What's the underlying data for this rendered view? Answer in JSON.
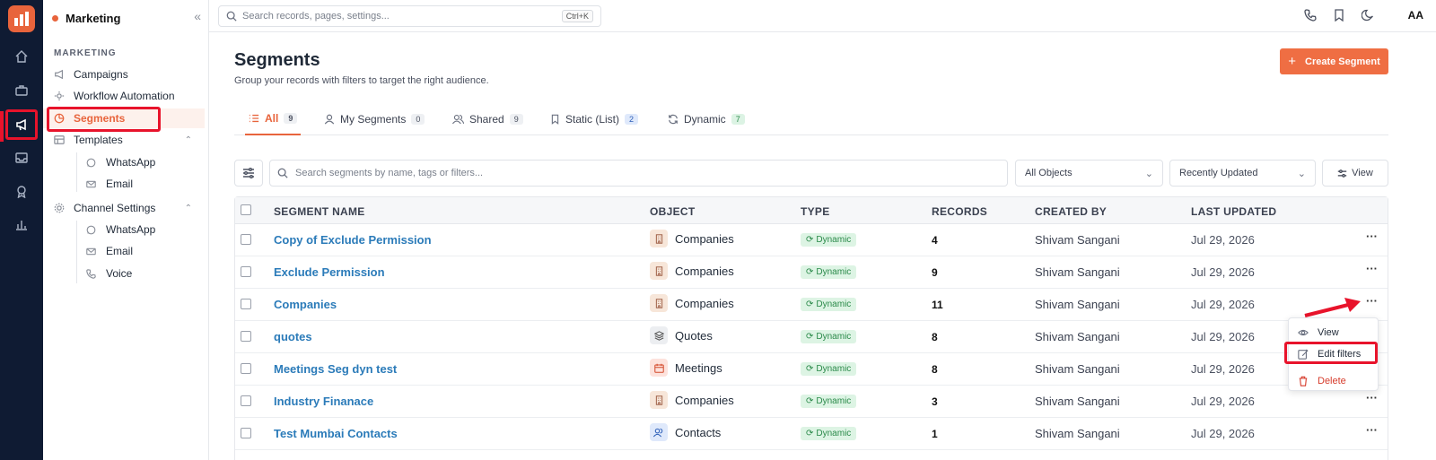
{
  "app": {
    "workspace": "Marketing"
  },
  "sidebar": {
    "section": "MARKETING",
    "items": [
      {
        "label": "Campaigns",
        "icon": "megaphone-icon"
      },
      {
        "label": "Workflow Automation",
        "icon": "workflow-icon"
      },
      {
        "label": "Segments",
        "icon": "pie-icon"
      },
      {
        "label": "Templates",
        "icon": "template-icon"
      },
      {
        "label": "Channel Settings",
        "icon": "settings-icon"
      }
    ],
    "templates_children": [
      "WhatsApp",
      "Email"
    ],
    "channel_children": [
      "WhatsApp",
      "Email",
      "Voice"
    ]
  },
  "topbar": {
    "search_placeholder": "Search records, pages, settings...",
    "shortcut": "Ctrl+K",
    "font_toggle": "AA"
  },
  "page": {
    "title": "Segments",
    "subtitle": "Group your records with filters to target the right audience.",
    "create_label": "Create Segment"
  },
  "tabs": [
    {
      "label": "All",
      "count": "9"
    },
    {
      "label": "My Segments",
      "count": "0"
    },
    {
      "label": "Shared",
      "count": "9"
    },
    {
      "label": "Static (List)",
      "count": "2"
    },
    {
      "label": "Dynamic",
      "count": "7"
    }
  ],
  "toolbar": {
    "search_placeholder": "Search segments by name, tags or filters...",
    "object_filter": "All Objects",
    "sort": "Recently Updated",
    "view": "View"
  },
  "table": {
    "headers": [
      "SEGMENT NAME",
      "OBJECT",
      "TYPE",
      "RECORDS",
      "CREATED BY",
      "LAST UPDATED"
    ],
    "rows": [
      {
        "name": "Copy of Exclude Permission",
        "object": "Companies",
        "type": "Dynamic",
        "records": "4",
        "created_by": "Shivam Sangani",
        "updated": "Jul 29, 2026"
      },
      {
        "name": "Exclude Permission",
        "object": "Companies",
        "type": "Dynamic",
        "records": "9",
        "created_by": "Shivam Sangani",
        "updated": "Jul 29, 2026"
      },
      {
        "name": "Companies",
        "object": "Companies",
        "type": "Dynamic",
        "records": "11",
        "created_by": "Shivam Sangani",
        "updated": "Jul 29, 2026"
      },
      {
        "name": "quotes",
        "object": "Quotes",
        "type": "Dynamic",
        "records": "8",
        "created_by": "Shivam Sangani",
        "updated": "Jul 29, 2026"
      },
      {
        "name": "Meetings Seg dyn test",
        "object": "Meetings",
        "type": "Dynamic",
        "records": "8",
        "created_by": "Shivam Sangani",
        "updated": "Jul 29, 2026"
      },
      {
        "name": "Industry Finanace",
        "object": "Companies",
        "type": "Dynamic",
        "records": "3",
        "created_by": "Shivam Sangani",
        "updated": "Jul 29, 2026"
      },
      {
        "name": "Test Mumbai Contacts",
        "object": "Contacts",
        "type": "Dynamic",
        "records": "1",
        "created_by": "Shivam Sangani",
        "updated": "Jul 29, 2026"
      }
    ]
  },
  "row_menu": {
    "view": "View",
    "edit": "Edit filters",
    "delete": "Delete"
  },
  "colors": {
    "accent": "#ef6e43",
    "highlight": "#e8132b",
    "link": "#2b7bb9",
    "rail": "#0f1b33"
  }
}
